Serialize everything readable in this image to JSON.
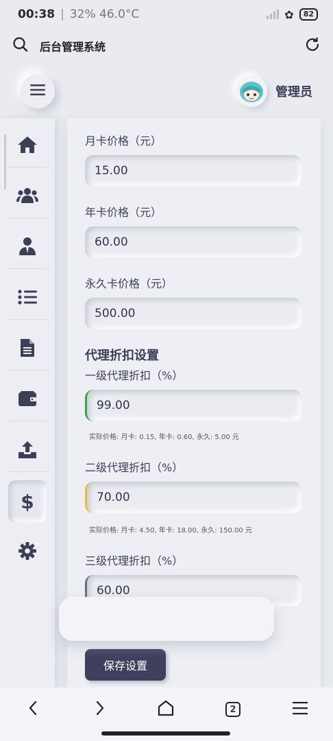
{
  "status_bar": {
    "time": "00:38",
    "separator": "|",
    "weather": "32% 46.0°C",
    "battery": "82"
  },
  "browser": {
    "page_title": "后台管理系统"
  },
  "header": {
    "admin_name": "管理员"
  },
  "sidebar": {
    "items": [
      {
        "icon": "home-icon"
      },
      {
        "icon": "users-icon"
      },
      {
        "icon": "user-icon"
      },
      {
        "icon": "list-icon"
      },
      {
        "icon": "document-icon"
      },
      {
        "icon": "wallet-icon"
      },
      {
        "icon": "upload-icon"
      },
      {
        "icon": "dollar-icon",
        "active": true
      },
      {
        "icon": "gear-icon"
      }
    ]
  },
  "form": {
    "monthly_label": "月卡价格（元）",
    "monthly_value": "15.00",
    "yearly_label": "年卡价格（元）",
    "yearly_value": "60.00",
    "permanent_label": "永久卡价格（元）",
    "permanent_value": "500.00",
    "agent_section_title": "代理折扣设置",
    "level1_label": "一级代理折扣（%）",
    "level1_value": "99.00",
    "level1_hint": "实际价格: 月卡: 0.15, 年卡: 0.60, 永久: 5.00 元",
    "level2_label": "二级代理折扣（%）",
    "level2_value": "70.00",
    "level2_hint": "实际价格: 月卡: 4.50, 年卡: 18.00, 永久: 150.00 元",
    "level3_label": "三级代理折扣（%）",
    "level3_value": "60.00",
    "save_label": "保存设置"
  },
  "bottom_nav": {
    "tab_count": "2"
  },
  "colors": {
    "accent": "#40405e",
    "green": "#3aa040",
    "yellow": "#f1bb2e",
    "background": "#e9ebf0"
  }
}
